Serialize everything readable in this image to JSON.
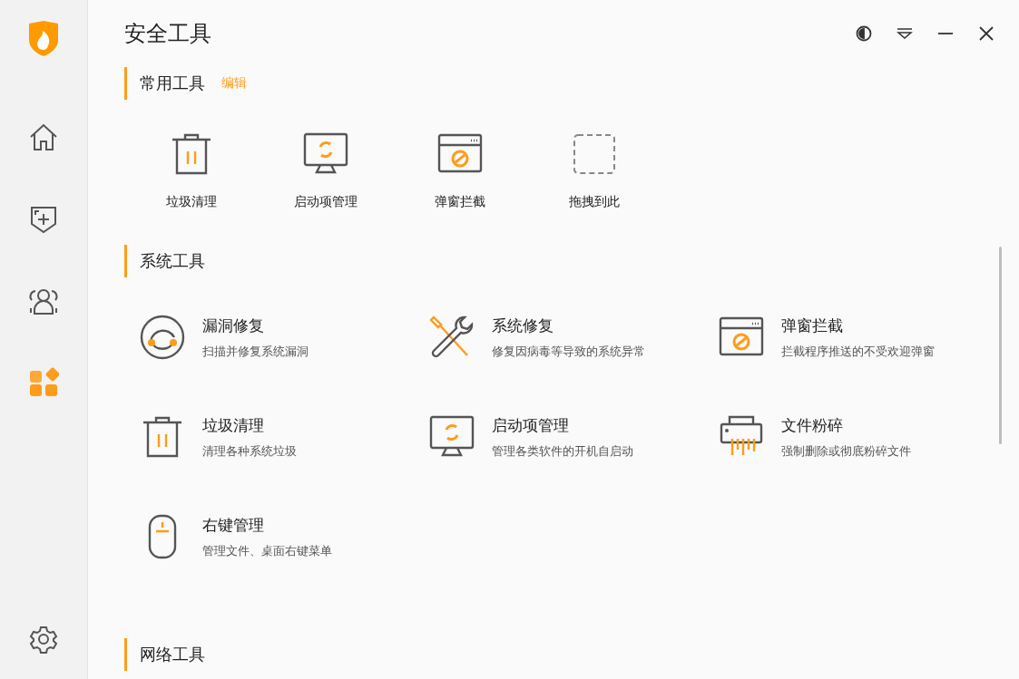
{
  "window": {
    "title": "安全工具"
  },
  "nav": [
    {
      "kind": "home",
      "selected": false
    },
    {
      "kind": "shield",
      "selected": false
    },
    {
      "kind": "people",
      "selected": false
    },
    {
      "kind": "apps",
      "selected": true
    }
  ],
  "common": {
    "title": "常用工具",
    "edit": "编辑",
    "items": [
      {
        "kind": "trash",
        "label": "垃圾清理"
      },
      {
        "kind": "startup",
        "label": "启动项管理"
      },
      {
        "kind": "popup",
        "label": "弹窗拦截"
      },
      {
        "kind": "drop",
        "label": "拖拽到此"
      }
    ]
  },
  "system": {
    "title": "系统工具",
    "items": [
      {
        "kind": "vuln",
        "name": "漏洞修复",
        "desc": "扫描并修复系统漏洞"
      },
      {
        "kind": "repair",
        "name": "系统修复",
        "desc": "修复因病毒等导致的系统异常"
      },
      {
        "kind": "popup",
        "name": "弹窗拦截",
        "desc": "拦截程序推送的不受欢迎弹窗"
      },
      {
        "kind": "trash",
        "name": "垃圾清理",
        "desc": "清理各种系统垃圾"
      },
      {
        "kind": "startup",
        "name": "启动项管理",
        "desc": "管理各类软件的开机自启动"
      },
      {
        "kind": "shredder",
        "name": "文件粉碎",
        "desc": "强制删除或彻底粉碎文件"
      },
      {
        "kind": "mouse",
        "name": "右键管理",
        "desc": "管理文件、桌面右键菜单"
      }
    ]
  },
  "network": {
    "title": "网络工具"
  }
}
